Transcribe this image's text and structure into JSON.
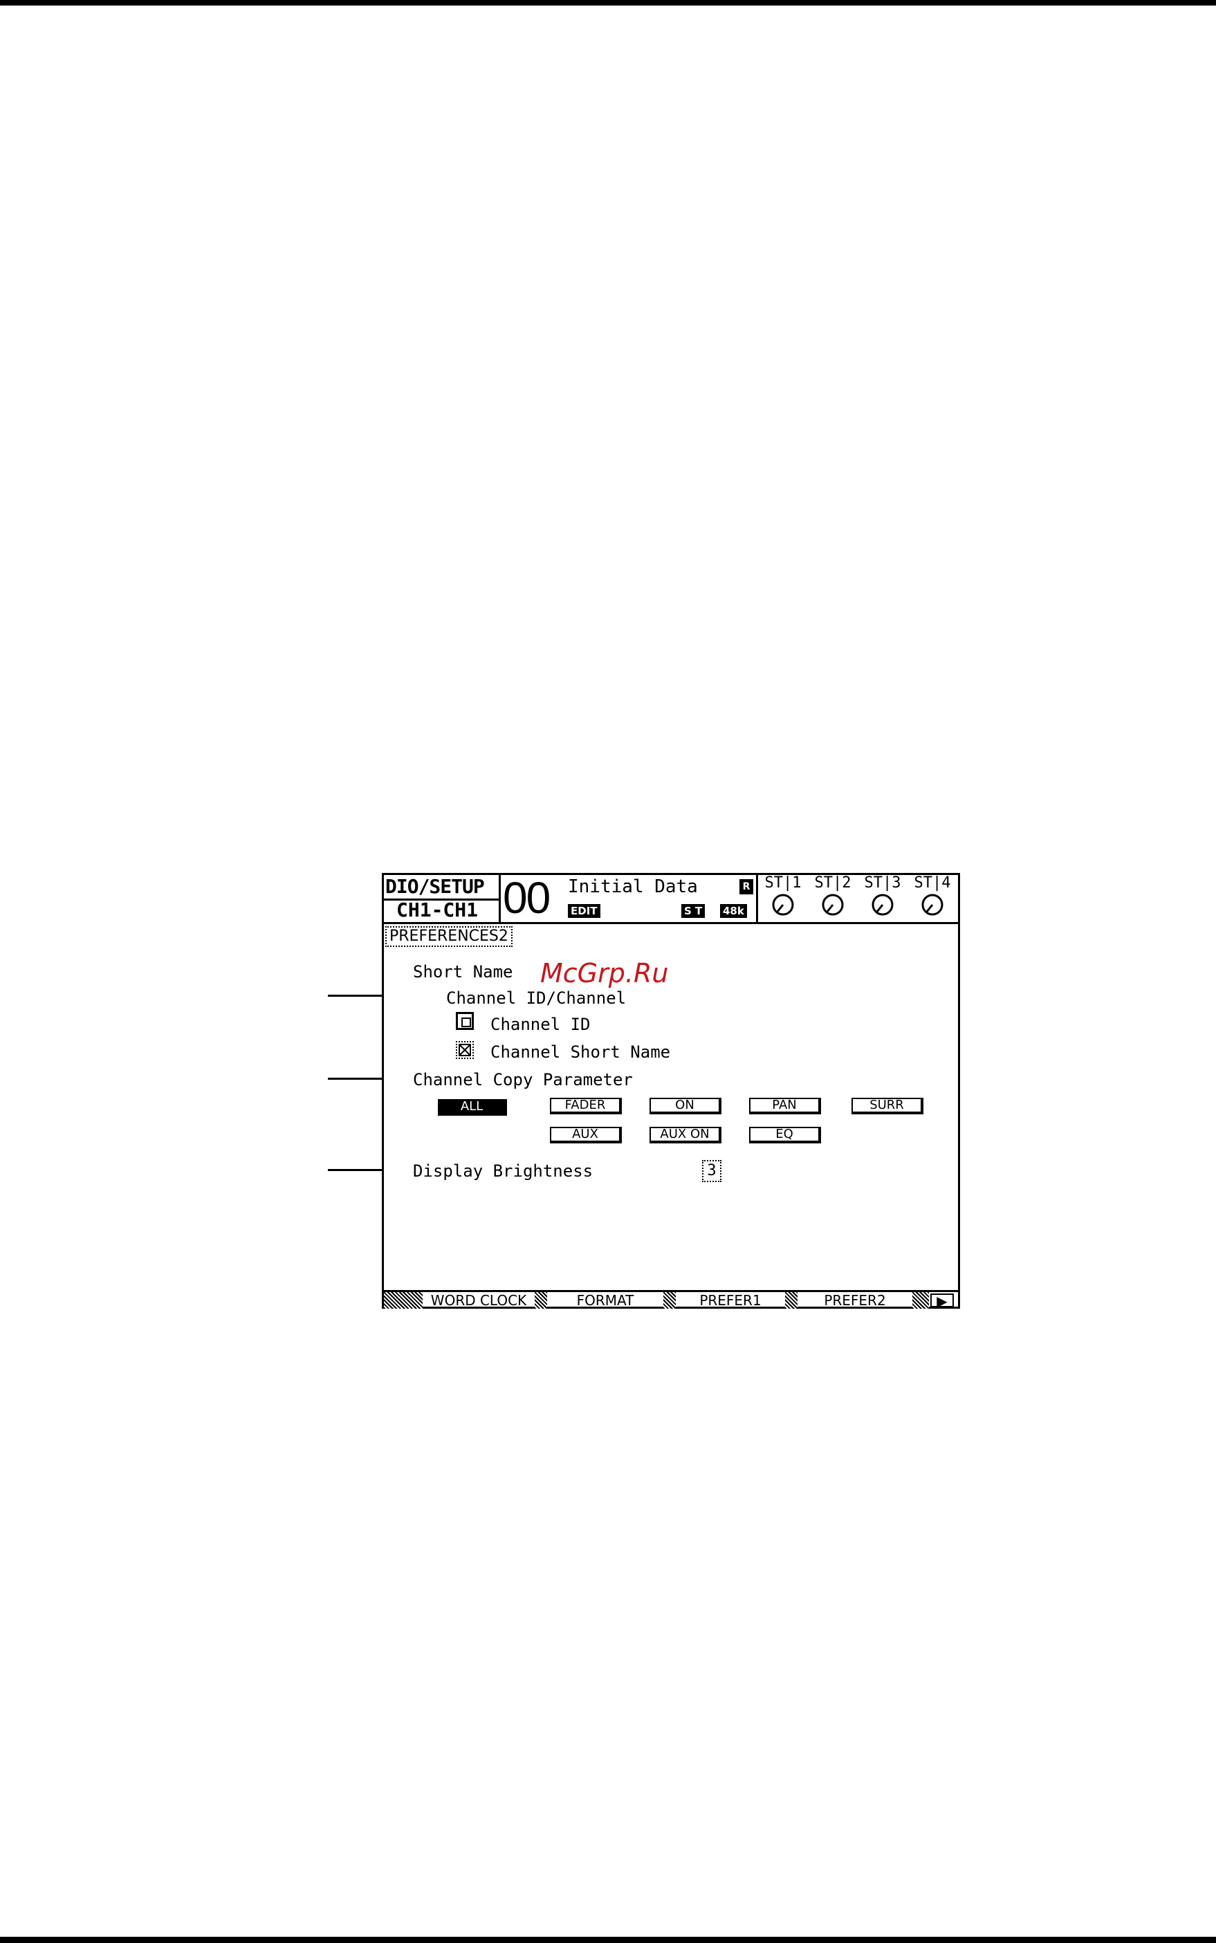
{
  "header": {
    "screen_title": "DIO/SETUP",
    "channel": "CH1-CH1",
    "scene_number": "00",
    "scene_title": "Initial Data",
    "protect_indicator": "R",
    "edit_tag": "EDIT",
    "st_tag": "S T",
    "fs_tag": "48k",
    "st_inputs": [
      "ST‌|1",
      "ST|2",
      "ST|3",
      "ST|4"
    ]
  },
  "page": {
    "title": "PREFERENCES2",
    "short_name_label": "Short Name",
    "channel_id_group_label": "Channel ID/Channel",
    "option_channel_id": "Channel ID",
    "option_short_name": "Channel Short Name",
    "copy_group_label": "Channel Copy Parameter",
    "copy_buttons": [
      "ALL",
      "FADER",
      "ON",
      "PAN",
      "SURR",
      "AUX",
      "AUX ON",
      "EQ"
    ],
    "brightness_label": "Display Brightness",
    "brightness_value": "3"
  },
  "tabs": [
    "WORD CLOCK",
    "FORMAT",
    "PREFER1",
    "PREFER2",
    "▶"
  ],
  "watermark": "McGrp.Ru",
  "colors": {
    "watermark": "#c4161c",
    "lcd_ink": "#000000",
    "background": "#ffffff"
  }
}
